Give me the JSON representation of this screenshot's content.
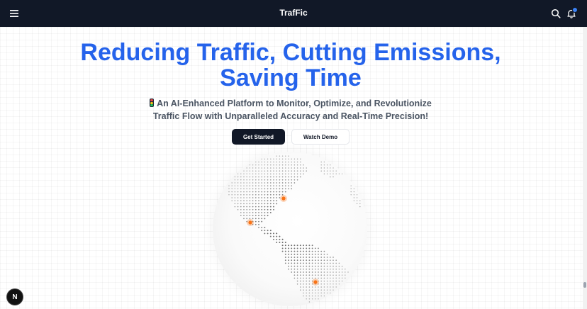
{
  "navbar": {
    "brand": "TrafFic",
    "menu_icon": "hamburger-menu-icon",
    "search_icon": "search-icon",
    "notification_icon": "bell-icon"
  },
  "hero": {
    "title": "Reducing Traffic, Cutting Emissions, Saving Time",
    "subtitle": "An AI-Enhanced Platform to Monitor, Optimize, and Revolutionize Traffic Flow with Unparalleled Accuracy and Real-Time Precision!",
    "subtitle_icon": "traffic-light-icon"
  },
  "actions": {
    "get_started": "Get Started",
    "watch_demo": "Watch Demo"
  },
  "badge": {
    "label": "N"
  },
  "colors": {
    "navbar_bg": "#111827",
    "accent": "#2563eb",
    "marker": "#f97316"
  }
}
